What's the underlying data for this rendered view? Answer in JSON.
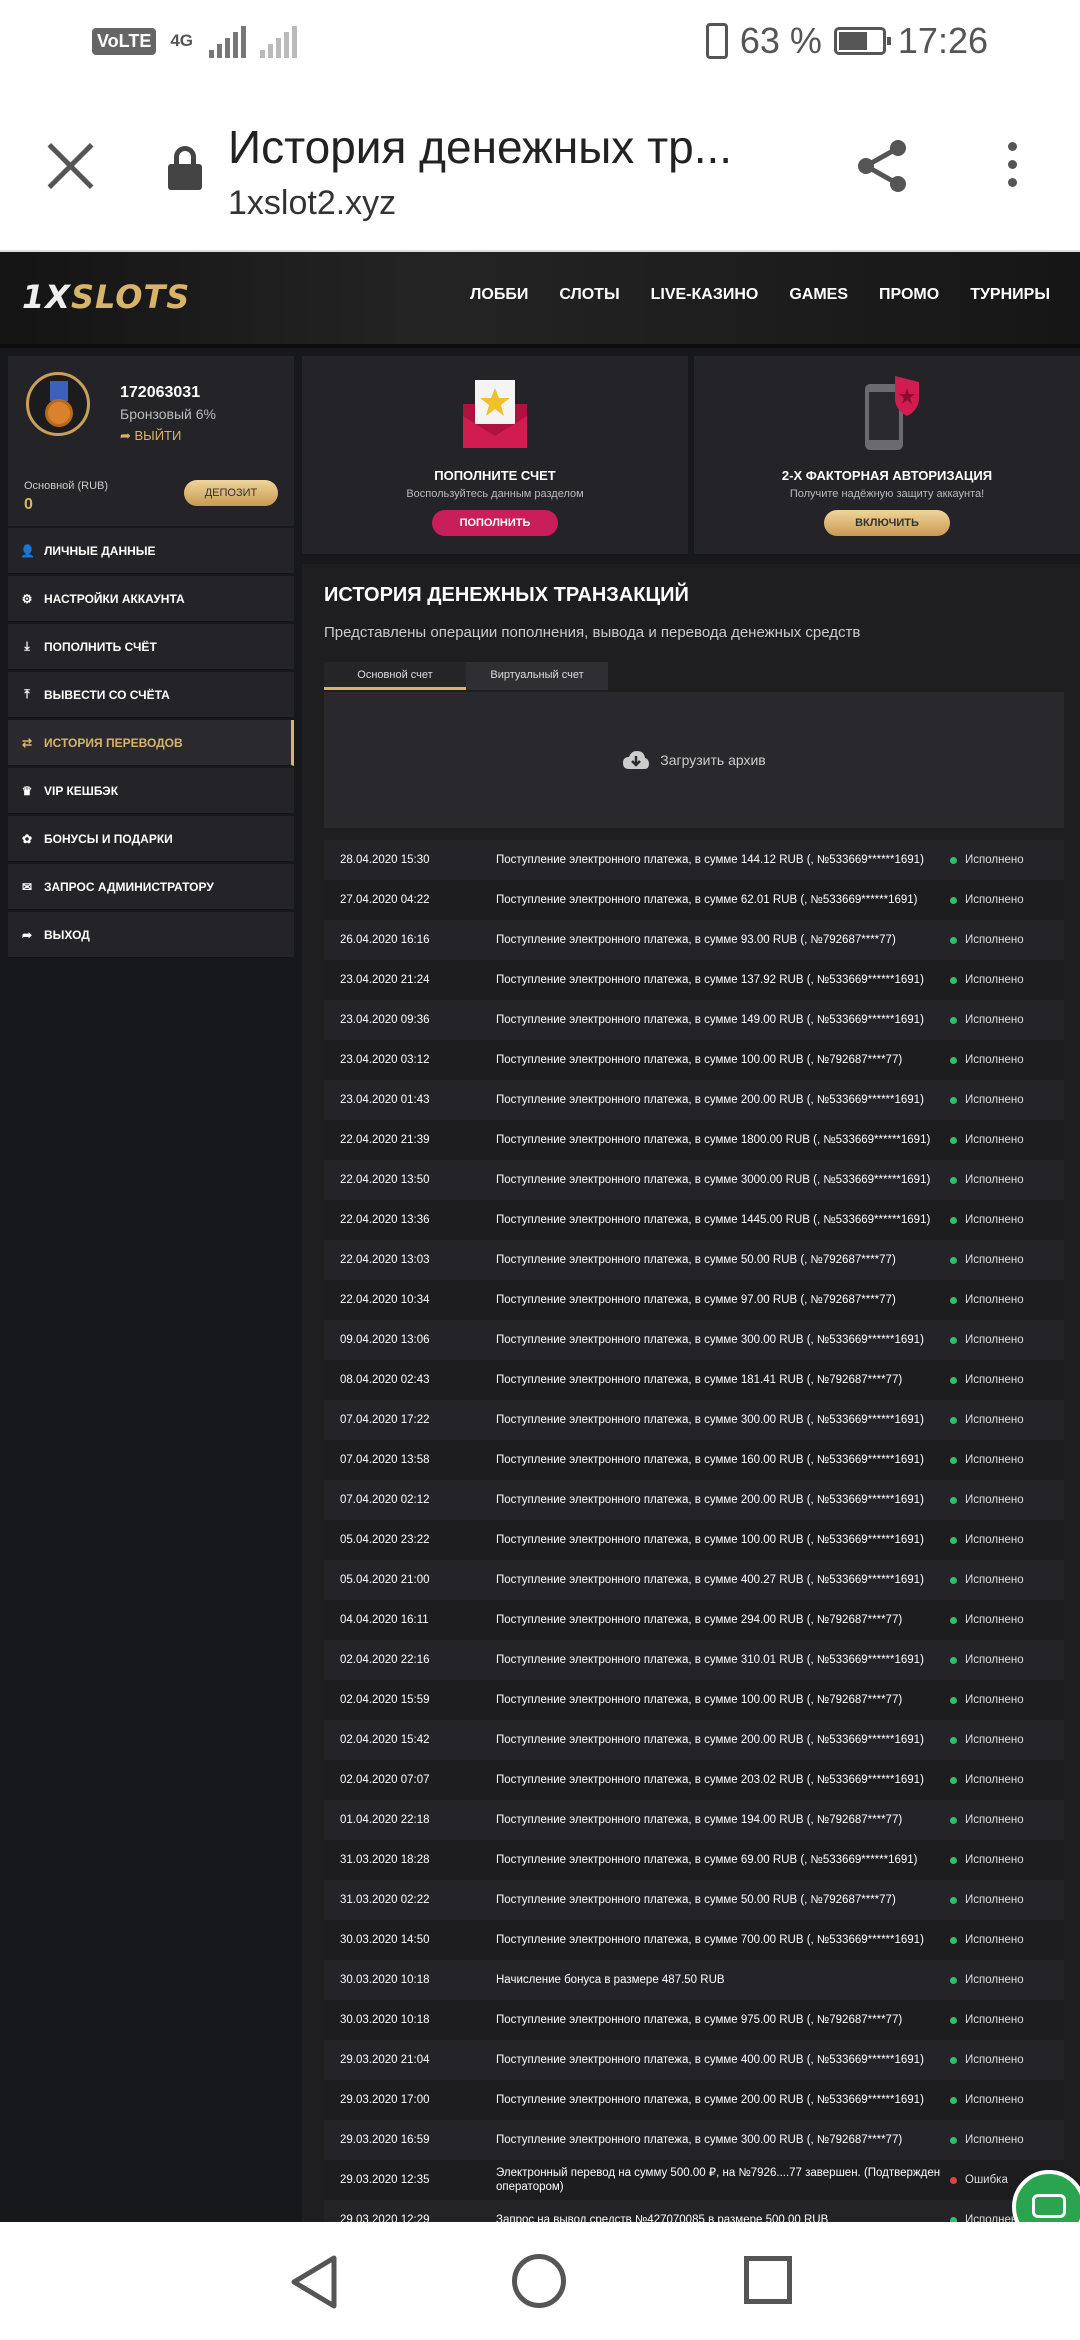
{
  "status_bar": {
    "volte": "VoLTE",
    "network": "4G",
    "battery_percent": "63 %",
    "time": "17:26"
  },
  "browser": {
    "title": "История денежных тр...",
    "url": "1xslot2.xyz"
  },
  "site": {
    "logo_a": "1X",
    "logo_b": "SLOTS",
    "menu": [
      "ЛОББИ",
      "СЛОТЫ",
      "LIVE-КАЗИНО",
      "GAMES",
      "ПРОМО",
      "ТУРНИРЫ"
    ]
  },
  "profile": {
    "user_id": "172063031",
    "rank": "Бронзовый 6%",
    "logout": "ВЫЙТИ",
    "balance_label": "Основной (RUB)",
    "balance_value": "0",
    "deposit_button": "ДЕПОЗИТ"
  },
  "sidebar": {
    "items": [
      {
        "label": "ЛИЧНЫЕ ДАННЫЕ",
        "icon": "user-plus-icon"
      },
      {
        "label": "НАСТРОЙКИ АККАУНТА",
        "icon": "gears-icon"
      },
      {
        "label": "ПОПОЛНИТЬ СЧЁТ",
        "icon": "download-icon"
      },
      {
        "label": "ВЫВЕСТИ СО СЧЁТА",
        "icon": "upload-icon"
      },
      {
        "label": "ИСТОРИЯ ПЕРЕВОДОВ",
        "icon": "transfer-icon"
      },
      {
        "label": "VIP КЕШБЭК",
        "icon": "crown-icon"
      },
      {
        "label": "БОНУСЫ И ПОДАРКИ",
        "icon": "gift-icon"
      },
      {
        "label": "ЗАПРОС АДМИНИСТРАТОРУ",
        "icon": "mail-icon"
      },
      {
        "label": "ВЫХОД",
        "icon": "sign-out-icon"
      }
    ]
  },
  "promos": {
    "deposit": {
      "title": "ПОПОЛНИТЕ СЧЕТ",
      "text": "Воспользуйтесь данным разделом",
      "button": "ПОПОЛНИТЬ"
    },
    "twofa": {
      "title": "2-Х ФАКТОРНАЯ АВТОРИЗАЦИЯ",
      "text": "Получите надёжную защиту аккаунта!",
      "button": "ВКЛЮЧИТЬ"
    }
  },
  "history": {
    "title": "ИСТОРИЯ ДЕНЕЖНЫХ ТРАНЗАКЦИЙ",
    "subtitle": "Представлены операции пополнения, вывода и перевода денежных средств",
    "tabs": [
      "Основной счет",
      "Виртуальный счет"
    ],
    "archive": "Загрузить архив",
    "rows": [
      {
        "date": "28.04.2020 15:30",
        "desc": "Поступление электронного платежа, в сумме 144.12 RUB (, №533669******1691)",
        "status": "Исполнено",
        "ok": true
      },
      {
        "date": "27.04.2020 04:22",
        "desc": "Поступление электронного платежа, в сумме 62.01 RUB (, №533669******1691)",
        "status": "Исполнено",
        "ok": true
      },
      {
        "date": "26.04.2020 16:16",
        "desc": "Поступление электронного платежа, в сумме 93.00 RUB (, №792687****77)",
        "status": "Исполнено",
        "ok": true
      },
      {
        "date": "23.04.2020 21:24",
        "desc": "Поступление электронного платежа, в сумме 137.92 RUB (, №533669******1691)",
        "status": "Исполнено",
        "ok": true
      },
      {
        "date": "23.04.2020 09:36",
        "desc": "Поступление электронного платежа, в сумме 149.00 RUB (, №533669******1691)",
        "status": "Исполнено",
        "ok": true
      },
      {
        "date": "23.04.2020 03:12",
        "desc": "Поступление электронного платежа, в сумме 100.00 RUB (, №792687****77)",
        "status": "Исполнено",
        "ok": true
      },
      {
        "date": "23.04.2020 01:43",
        "desc": "Поступление электронного платежа, в сумме 200.00 RUB (, №533669******1691)",
        "status": "Исполнено",
        "ok": true
      },
      {
        "date": "22.04.2020 21:39",
        "desc": "Поступление электронного платежа, в сумме 1800.00 RUB (, №533669******1691)",
        "status": "Исполнено",
        "ok": true
      },
      {
        "date": "22.04.2020 13:50",
        "desc": "Поступление электронного платежа, в сумме 3000.00 RUB (, №533669******1691)",
        "status": "Исполнено",
        "ok": true
      },
      {
        "date": "22.04.2020 13:36",
        "desc": "Поступление электронного платежа, в сумме 1445.00 RUB (, №533669******1691)",
        "status": "Исполнено",
        "ok": true
      },
      {
        "date": "22.04.2020 13:03",
        "desc": "Поступление электронного платежа, в сумме 50.00 RUB (, №792687****77)",
        "status": "Исполнено",
        "ok": true
      },
      {
        "date": "22.04.2020 10:34",
        "desc": "Поступление электронного платежа, в сумме 97.00 RUB (, №792687****77)",
        "status": "Исполнено",
        "ok": true
      },
      {
        "date": "09.04.2020 13:06",
        "desc": "Поступление электронного платежа, в сумме 300.00 RUB (, №533669******1691)",
        "status": "Исполнено",
        "ok": true
      },
      {
        "date": "08.04.2020 02:43",
        "desc": "Поступление электронного платежа, в сумме 181.41 RUB (, №792687****77)",
        "status": "Исполнено",
        "ok": true
      },
      {
        "date": "07.04.2020 17:22",
        "desc": "Поступление электронного платежа, в сумме 300.00 RUB (, №533669******1691)",
        "status": "Исполнено",
        "ok": true
      },
      {
        "date": "07.04.2020 13:58",
        "desc": "Поступление электронного платежа, в сумме 160.00 RUB (, №533669******1691)",
        "status": "Исполнено",
        "ok": true
      },
      {
        "date": "07.04.2020 02:12",
        "desc": "Поступление электронного платежа, в сумме 200.00 RUB (, №533669******1691)",
        "status": "Исполнено",
        "ok": true
      },
      {
        "date": "05.04.2020 23:22",
        "desc": "Поступление электронного платежа, в сумме 100.00 RUB (, №533669******1691)",
        "status": "Исполнено",
        "ok": true
      },
      {
        "date": "05.04.2020 21:00",
        "desc": "Поступление электронного платежа, в сумме 400.27 RUB (, №533669******1691)",
        "status": "Исполнено",
        "ok": true
      },
      {
        "date": "04.04.2020 16:11",
        "desc": "Поступление электронного платежа, в сумме 294.00 RUB (, №792687****77)",
        "status": "Исполнено",
        "ok": true
      },
      {
        "date": "02.04.2020 22:16",
        "desc": "Поступление электронного платежа, в сумме 310.01 RUB (, №533669******1691)",
        "status": "Исполнено",
        "ok": true
      },
      {
        "date": "02.04.2020 15:59",
        "desc": "Поступление электронного платежа, в сумме 100.00 RUB (, №792687****77)",
        "status": "Исполнено",
        "ok": true
      },
      {
        "date": "02.04.2020 15:42",
        "desc": "Поступление электронного платежа, в сумме 200.00 RUB (, №533669******1691)",
        "status": "Исполнено",
        "ok": true
      },
      {
        "date": "02.04.2020 07:07",
        "desc": "Поступление электронного платежа, в сумме 203.02 RUB (, №533669******1691)",
        "status": "Исполнено",
        "ok": true
      },
      {
        "date": "01.04.2020 22:18",
        "desc": "Поступление электронного платежа, в сумме 194.00 RUB (, №792687****77)",
        "status": "Исполнено",
        "ok": true
      },
      {
        "date": "31.03.2020 18:28",
        "desc": "Поступление электронного платежа, в сумме 69.00 RUB (, №533669******1691)",
        "status": "Исполнено",
        "ok": true
      },
      {
        "date": "31.03.2020 02:22",
        "desc": "Поступление электронного платежа, в сумме 50.00 RUB (, №792687****77)",
        "status": "Исполнено",
        "ok": true
      },
      {
        "date": "30.03.2020 14:50",
        "desc": "Поступление электронного платежа, в сумме 700.00 RUB (, №533669******1691)",
        "status": "Исполнено",
        "ok": true
      },
      {
        "date": "30.03.2020 10:18",
        "desc": "Начисление бонуса в размере 487.50 RUB",
        "status": "Исполнено",
        "ok": true
      },
      {
        "date": "30.03.2020 10:18",
        "desc": "Поступление электронного платежа, в сумме 975.00 RUB (, №792687****77)",
        "status": "Исполнено",
        "ok": true
      },
      {
        "date": "29.03.2020 21:04",
        "desc": "Поступление электронного платежа, в сумме 400.00 RUB (, №533669******1691)",
        "status": "Исполнено",
        "ok": true
      },
      {
        "date": "29.03.2020 17:00",
        "desc": "Поступление электронного платежа, в сумме 200.00 RUB (, №533669******1691)",
        "status": "Исполнено",
        "ok": true
      },
      {
        "date": "29.03.2020 16:59",
        "desc": "Поступление электронного платежа, в сумме 300.00 RUB (, №792687****77)",
        "status": "Исполнено",
        "ok": true
      },
      {
        "date": "29.03.2020 12:35",
        "desc": "Электронный перевод на сумму 500.00 ₽, на №7926....77 завершен. (Подтвержден оператором)",
        "status": "Ошибка",
        "ok": false
      },
      {
        "date": "29.03.2020 12:29",
        "desc": "Запрос на вывод средств №427070085 в размере 500.00 RUB",
        "status": "Исполнено",
        "ok": true
      }
    ]
  }
}
